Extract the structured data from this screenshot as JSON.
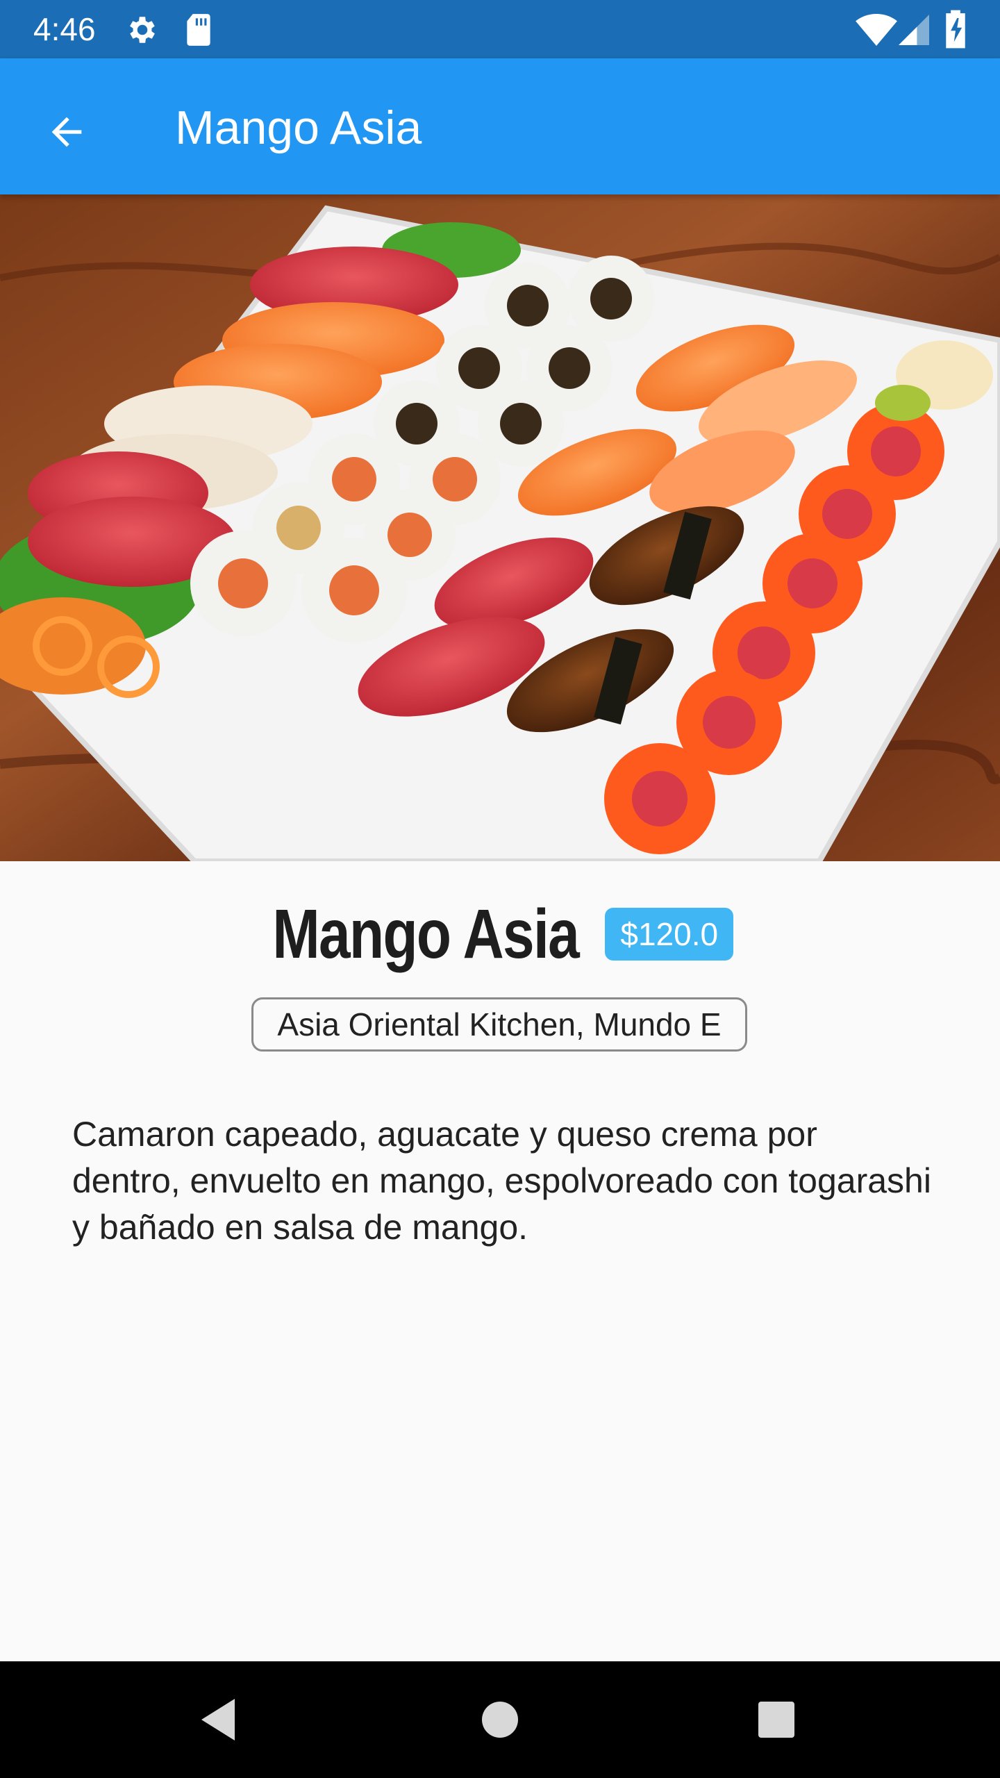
{
  "status_bar": {
    "time": "4:46",
    "icons": [
      "gear-icon",
      "sd-card-icon",
      "wifi-icon",
      "signal-icon",
      "battery-charging-icon"
    ]
  },
  "app_bar": {
    "title": "Mango Asia",
    "back_icon": "arrow-back-icon"
  },
  "hero_image": {
    "subject": "sushi-platter"
  },
  "dish": {
    "name": "Mango Asia",
    "price": "$120.0",
    "restaurant": "Asia Oriental Kitchen, Mundo E",
    "description": "Camaron capeado, aguacate y queso crema por dentro, envuelto en mango, espolvoreado con togarashi y bañado en salsa de mango."
  },
  "nav_bar": {
    "icons": [
      "back-triangle-icon",
      "home-circle-icon",
      "recents-square-icon"
    ]
  },
  "colors": {
    "status_bar": "#1b6db5",
    "app_bar": "#2196f3",
    "price_badge": "#41b6f5",
    "background": "#fafafa"
  }
}
